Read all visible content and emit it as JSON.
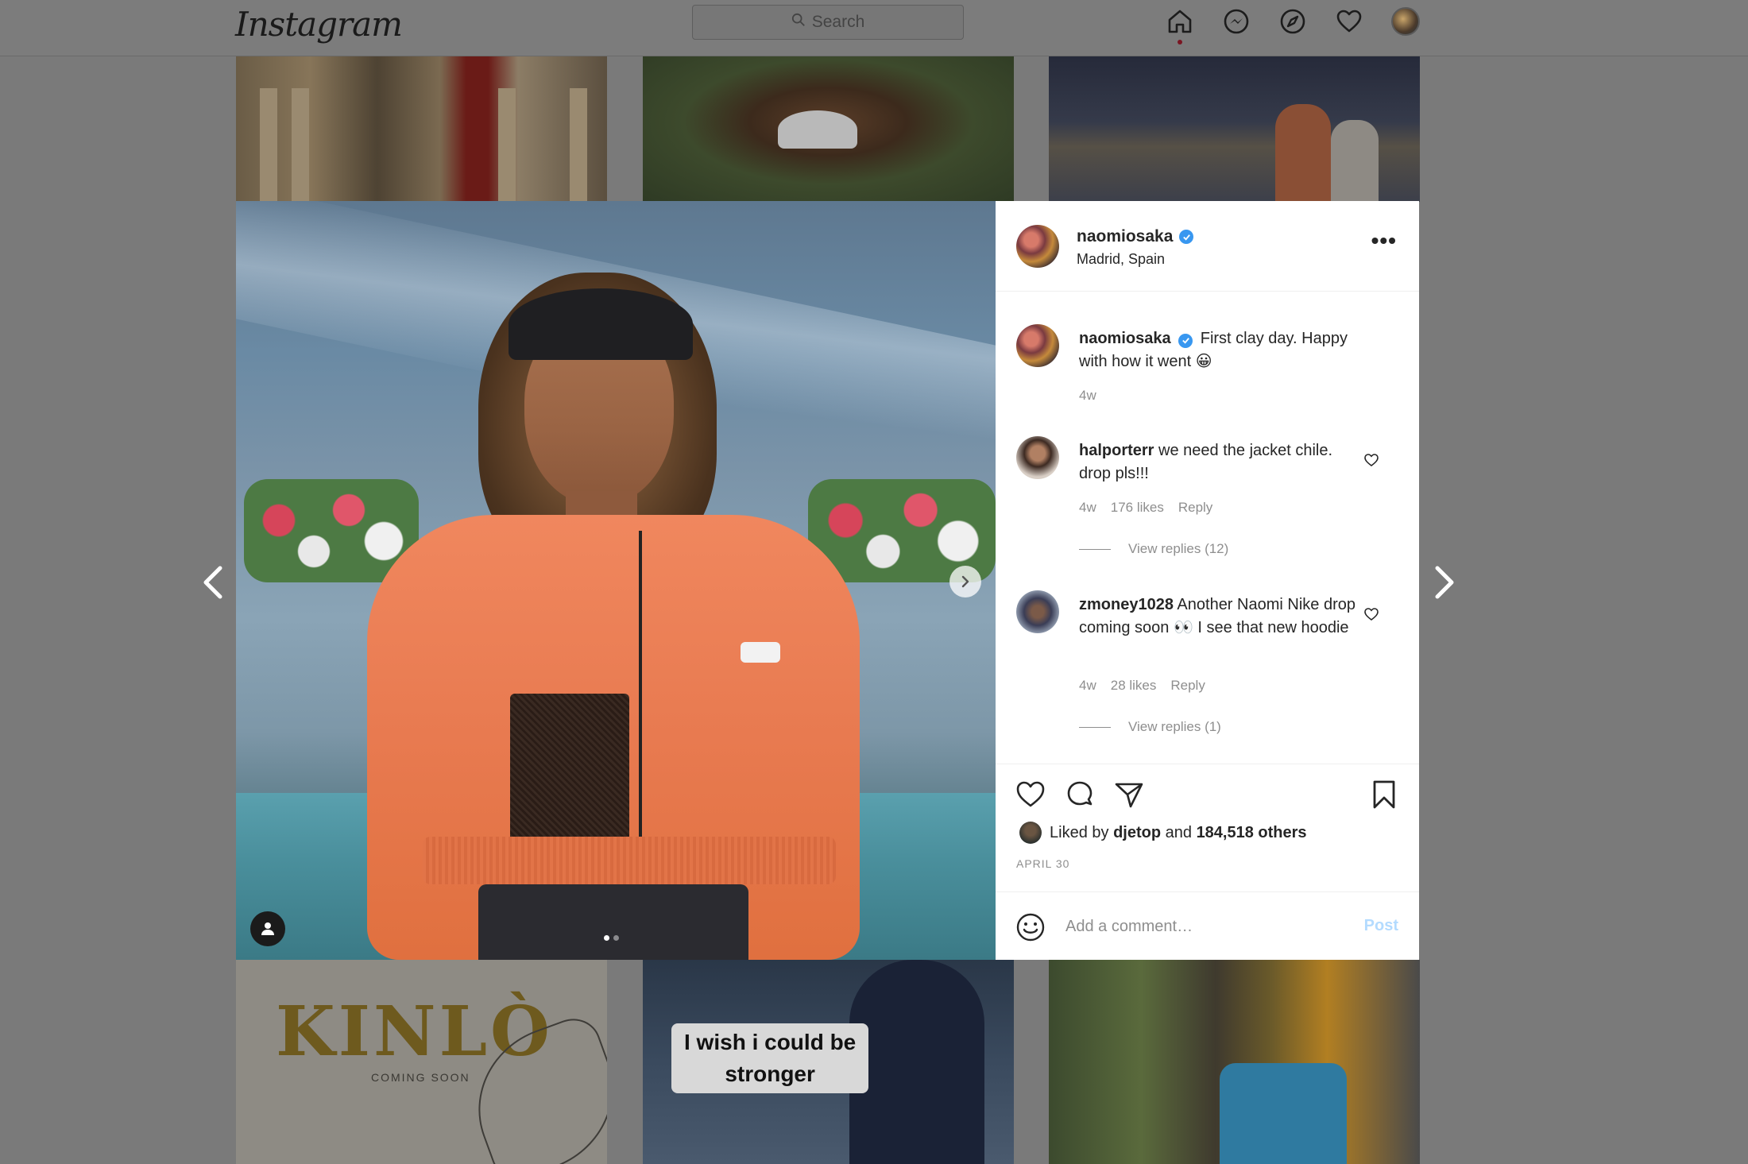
{
  "app": {
    "logo": "Instagram"
  },
  "search": {
    "placeholder": "Search"
  },
  "nav": {
    "icons": [
      "home-icon",
      "messenger-icon",
      "explore-icon",
      "heart-icon",
      "profile-avatar"
    ]
  },
  "tiles": {
    "kinlo_title": "KINLÒ",
    "kinlo_subtitle": "COMING SOON",
    "tiktok_caption_line1": "I wish i could be",
    "tiktok_caption_line2": "stronger"
  },
  "post": {
    "username": "naomiosaka",
    "location": "Madrid, Spain",
    "more_label": "•••",
    "caption": {
      "username": "naomiosaka",
      "text": "First clay day. Happy with how it went 😀",
      "time": "4w"
    },
    "comments": [
      {
        "username": "halporterr",
        "text": "we need the jacket chile. drop pls!!!",
        "time": "4w",
        "likes": "176 likes",
        "reply": "Reply",
        "view_replies": "View replies (12)"
      },
      {
        "username": "zmoney1028",
        "text": "Another Naomi Nike drop coming soon 👀 I see that new hoodie",
        "time": "4w",
        "likes": "28 likes",
        "reply": "Reply",
        "view_replies": "View replies (1)"
      }
    ],
    "liked_by_prefix": "Liked by",
    "liked_by_user": "djetop",
    "liked_by_and": "and",
    "liked_by_others": "184,518 others",
    "date": "APRIL 30",
    "comment_placeholder": "Add a comment…",
    "post_button": "Post",
    "carousel": {
      "current": 1,
      "total": 2
    }
  },
  "colors": {
    "accent": "#3897f0",
    "post_disabled": "#b3dbff",
    "overlay": "#7a7a7a"
  }
}
